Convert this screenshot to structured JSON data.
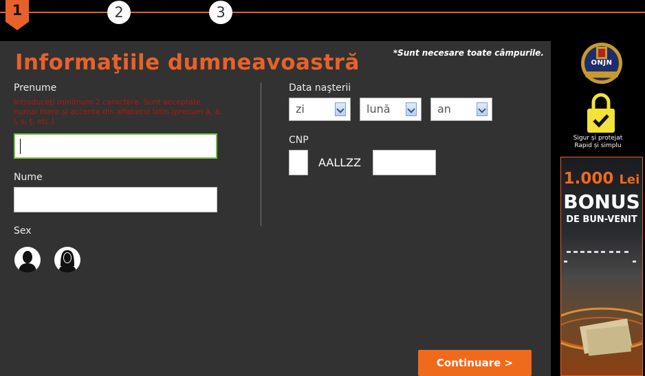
{
  "steps": {
    "step1": "1",
    "step2": "2",
    "step3": "3"
  },
  "form": {
    "title": "Informaţiile dumneavoastră",
    "required_note": "*Sunt necesare toate câmpurile.",
    "first_name": {
      "label": "Prenume",
      "hint": "Introduceţi minimum 2 caractere. Sunt acceptate numai litere și accente din alfabetul latin (precum ă, â, î, ș, ț, etc.)",
      "value": ""
    },
    "last_name": {
      "label": "Nume",
      "value": ""
    },
    "sex": {
      "label": "Sex",
      "male_icon": "male-avatar-icon",
      "female_icon": "female-avatar-icon"
    },
    "birth_date": {
      "label": "Data naşterii",
      "day": "zi",
      "month": "lună",
      "year": "an"
    },
    "cnp": {
      "label": "CNP",
      "format": "AALLZZ",
      "first_digit": "",
      "suffix": ""
    },
    "continue_label": "Continuare >"
  },
  "sidebar": {
    "seal_text": "ONJN",
    "secure_line1": "Sigur și protejat",
    "secure_line2": "Rapid și simplu",
    "banner": {
      "amount": "1.000",
      "currency": "Lei",
      "bonus": "BONUS",
      "welcome": "DE BUN-VENIT"
    }
  },
  "colors": {
    "accent": "#e8612a",
    "button": "#f06a1b",
    "panel": "#323232",
    "hint": "#b01a0f",
    "focus": "#6fbf3a"
  }
}
